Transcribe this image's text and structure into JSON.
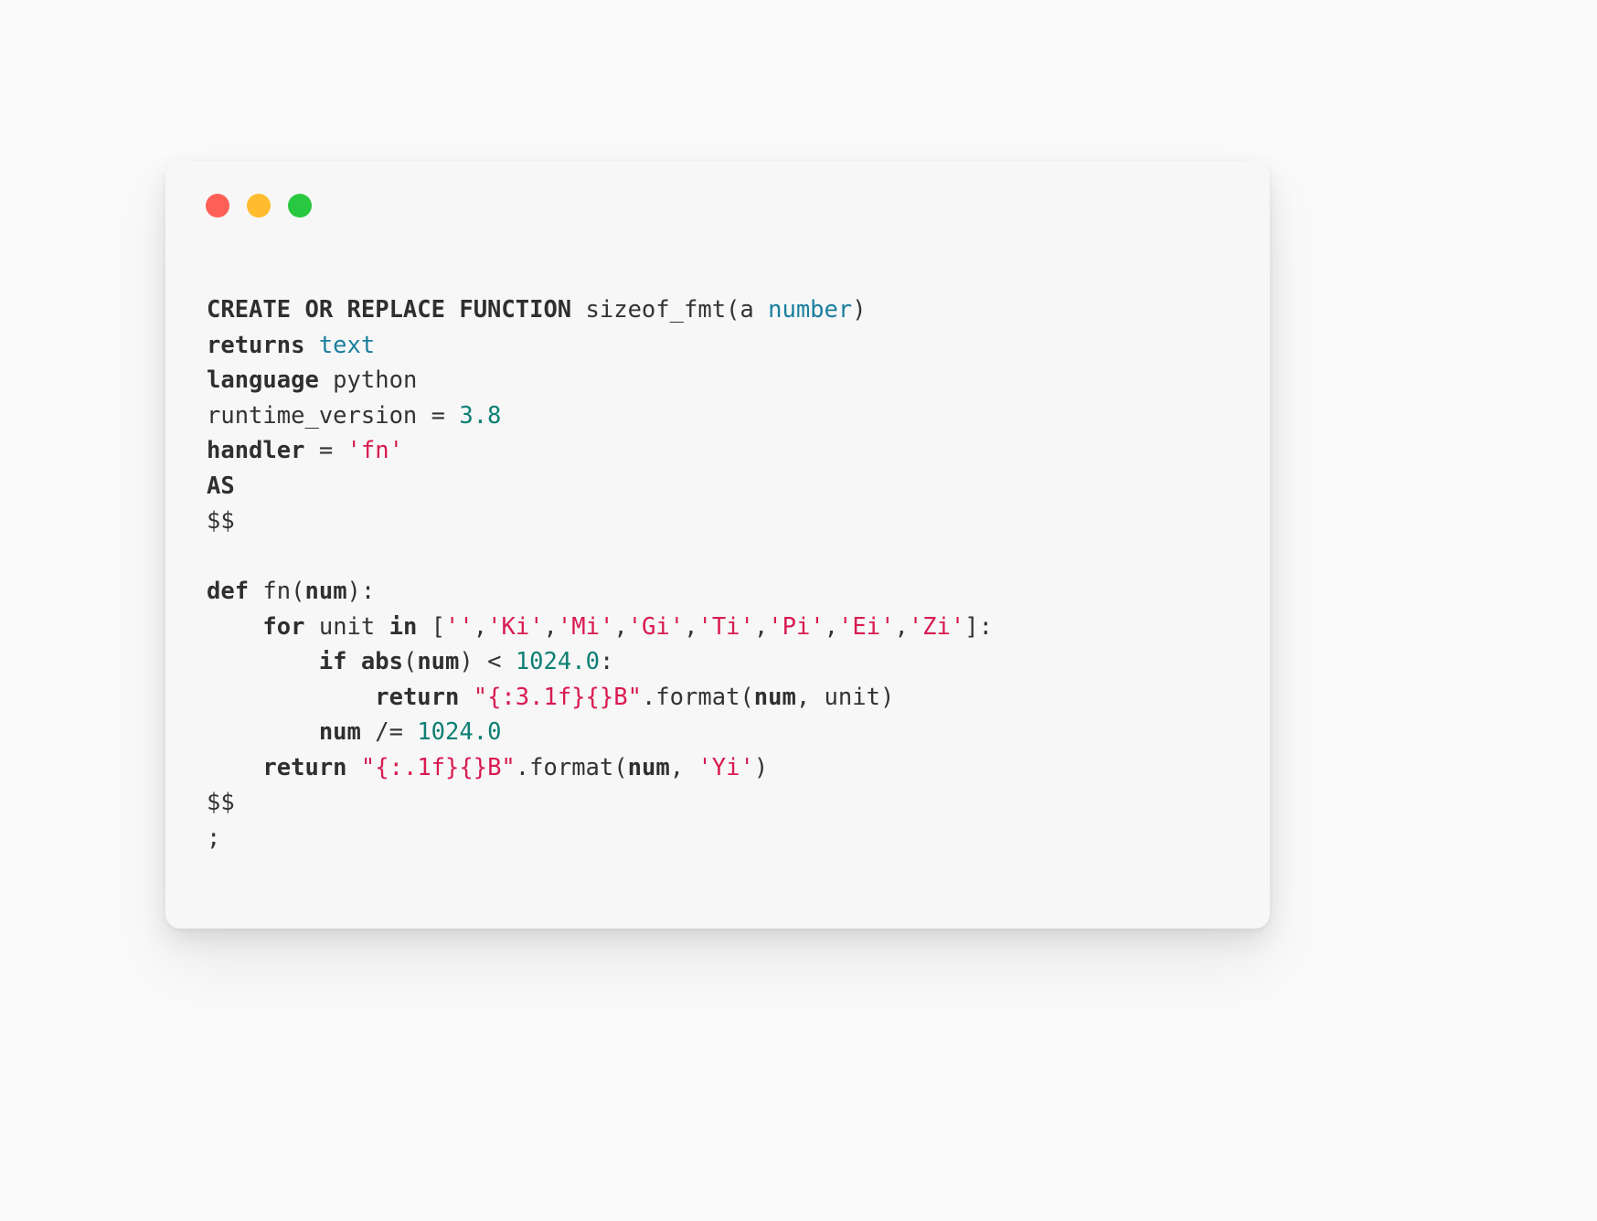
{
  "window": {
    "traffic_lights": [
      {
        "name": "close",
        "color": "#ff5f57"
      },
      {
        "name": "minimize",
        "color": "#febc2e"
      },
      {
        "name": "maximize",
        "color": "#28c840"
      }
    ]
  },
  "editor": {
    "language": "sql-python",
    "background": "#f7f7f7",
    "page_background": "#fafafa",
    "syntax_colors": {
      "plain": "#333333",
      "keyword": "#2f2f2f",
      "type": "#1a7f9e",
      "number": "#0d8074",
      "string": "#d81b50"
    },
    "lines": [
      {
        "n": 1,
        "tokens": [
          {
            "t": "CREATE OR REPLACE FUNCTION",
            "c": "kw"
          },
          {
            "t": " sizeof_fmt(a ",
            "c": "plain"
          },
          {
            "t": "number",
            "c": "type"
          },
          {
            "t": ")",
            "c": "plain"
          }
        ]
      },
      {
        "n": 2,
        "tokens": [
          {
            "t": "returns",
            "c": "kw"
          },
          {
            "t": " ",
            "c": "plain"
          },
          {
            "t": "text",
            "c": "type"
          }
        ]
      },
      {
        "n": 3,
        "tokens": [
          {
            "t": "language",
            "c": "kw"
          },
          {
            "t": " python",
            "c": "plain"
          }
        ]
      },
      {
        "n": 4,
        "tokens": [
          {
            "t": "runtime_version = ",
            "c": "plain"
          },
          {
            "t": "3.8",
            "c": "num"
          }
        ]
      },
      {
        "n": 5,
        "tokens": [
          {
            "t": "handler",
            "c": "kw"
          },
          {
            "t": " = ",
            "c": "plain"
          },
          {
            "t": "'fn'",
            "c": "str"
          }
        ]
      },
      {
        "n": 6,
        "tokens": [
          {
            "t": "AS",
            "c": "kw"
          }
        ]
      },
      {
        "n": 7,
        "tokens": [
          {
            "t": "$$",
            "c": "plain"
          }
        ]
      },
      {
        "n": 8,
        "tokens": [
          {
            "t": "",
            "c": "plain"
          }
        ]
      },
      {
        "n": 9,
        "tokens": [
          {
            "t": "def",
            "c": "kw"
          },
          {
            "t": " fn(",
            "c": "plain"
          },
          {
            "t": "num",
            "c": "bold"
          },
          {
            "t": "):",
            "c": "plain"
          }
        ]
      },
      {
        "n": 10,
        "tokens": [
          {
            "t": "    ",
            "c": "plain"
          },
          {
            "t": "for",
            "c": "kw"
          },
          {
            "t": " unit ",
            "c": "plain"
          },
          {
            "t": "in",
            "c": "kw"
          },
          {
            "t": " [",
            "c": "plain"
          },
          {
            "t": "''",
            "c": "str"
          },
          {
            "t": ",",
            "c": "plain"
          },
          {
            "t": "'Ki'",
            "c": "str"
          },
          {
            "t": ",",
            "c": "plain"
          },
          {
            "t": "'Mi'",
            "c": "str"
          },
          {
            "t": ",",
            "c": "plain"
          },
          {
            "t": "'Gi'",
            "c": "str"
          },
          {
            "t": ",",
            "c": "plain"
          },
          {
            "t": "'Ti'",
            "c": "str"
          },
          {
            "t": ",",
            "c": "plain"
          },
          {
            "t": "'Pi'",
            "c": "str"
          },
          {
            "t": ",",
            "c": "plain"
          },
          {
            "t": "'Ei'",
            "c": "str"
          },
          {
            "t": ",",
            "c": "plain"
          },
          {
            "t": "'Zi'",
            "c": "str"
          },
          {
            "t": "]:",
            "c": "plain"
          }
        ]
      },
      {
        "n": 11,
        "tokens": [
          {
            "t": "        ",
            "c": "plain"
          },
          {
            "t": "if",
            "c": "kw"
          },
          {
            "t": " ",
            "c": "plain"
          },
          {
            "t": "abs",
            "c": "bold"
          },
          {
            "t": "(",
            "c": "plain"
          },
          {
            "t": "num",
            "c": "bold"
          },
          {
            "t": ") < ",
            "c": "plain"
          },
          {
            "t": "1024.0",
            "c": "num"
          },
          {
            "t": ":",
            "c": "plain"
          }
        ]
      },
      {
        "n": 12,
        "tokens": [
          {
            "t": "            ",
            "c": "plain"
          },
          {
            "t": "return",
            "c": "kw"
          },
          {
            "t": " ",
            "c": "plain"
          },
          {
            "t": "\"{:3.1f}{}B\"",
            "c": "str"
          },
          {
            "t": ".format(",
            "c": "plain"
          },
          {
            "t": "num",
            "c": "bold"
          },
          {
            "t": ", unit)",
            "c": "plain"
          }
        ]
      },
      {
        "n": 13,
        "tokens": [
          {
            "t": "        ",
            "c": "plain"
          },
          {
            "t": "num",
            "c": "bold"
          },
          {
            "t": " /= ",
            "c": "plain"
          },
          {
            "t": "1024.0",
            "c": "num"
          }
        ]
      },
      {
        "n": 14,
        "tokens": [
          {
            "t": "    ",
            "c": "plain"
          },
          {
            "t": "return",
            "c": "kw"
          },
          {
            "t": " ",
            "c": "plain"
          },
          {
            "t": "\"{:.1f}{}B\"",
            "c": "str"
          },
          {
            "t": ".format(",
            "c": "plain"
          },
          {
            "t": "num",
            "c": "bold"
          },
          {
            "t": ", ",
            "c": "plain"
          },
          {
            "t": "'Yi'",
            "c": "str"
          },
          {
            "t": ")",
            "c": "plain"
          }
        ]
      },
      {
        "n": 15,
        "tokens": [
          {
            "t": "$$",
            "c": "plain"
          }
        ]
      },
      {
        "n": 16,
        "tokens": [
          {
            "t": ";",
            "c": "plain"
          }
        ]
      }
    ]
  }
}
